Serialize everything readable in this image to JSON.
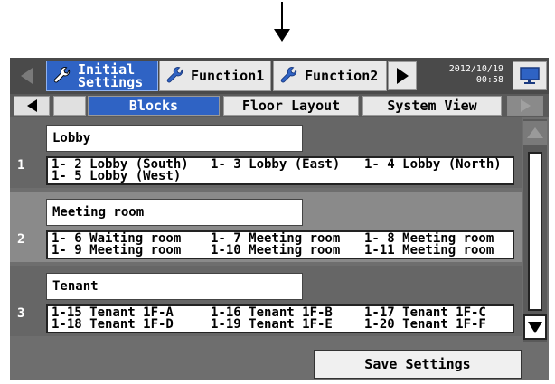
{
  "header": {
    "tabs": [
      {
        "label_line1": "Initial",
        "label_line2": "Settings",
        "active": true
      },
      {
        "label": "Function1",
        "active": false
      },
      {
        "label": "Function2",
        "active": false
      }
    ],
    "date": "2012/10/19",
    "time": "00:58"
  },
  "subnav": {
    "tabs": [
      {
        "label": "Blocks",
        "active": true
      },
      {
        "label": "Floor Layout",
        "active": false
      },
      {
        "label": "System View",
        "active": false
      }
    ]
  },
  "blocks": [
    {
      "number": "1",
      "name": "Lobby",
      "groups": [
        "1- 2 Lobby (South)",
        "1- 3 Lobby (East)",
        "1- 4 Lobby (North)",
        "1- 5 Lobby (West)"
      ]
    },
    {
      "number": "2",
      "name": "Meeting room",
      "groups": [
        "1- 6 Waiting room",
        "1- 7 Meeting room",
        "1- 8 Meeting room",
        "1- 9 Meeting room",
        "1-10 Meeting room",
        "1-11 Meeting room"
      ]
    },
    {
      "number": "3",
      "name": "Tenant",
      "groups": [
        "1-15 Tenant 1F-A",
        "1-16 Tenant 1F-B",
        "1-17 Tenant 1F-C",
        "1-18 Tenant 1F-D",
        "1-19 Tenant 1F-E",
        "1-20 Tenant 1F-F"
      ]
    }
  ],
  "footer": {
    "save_label": "Save Settings"
  },
  "colors": {
    "accent": "#2f63c4",
    "panel": "#6e6e6e"
  }
}
